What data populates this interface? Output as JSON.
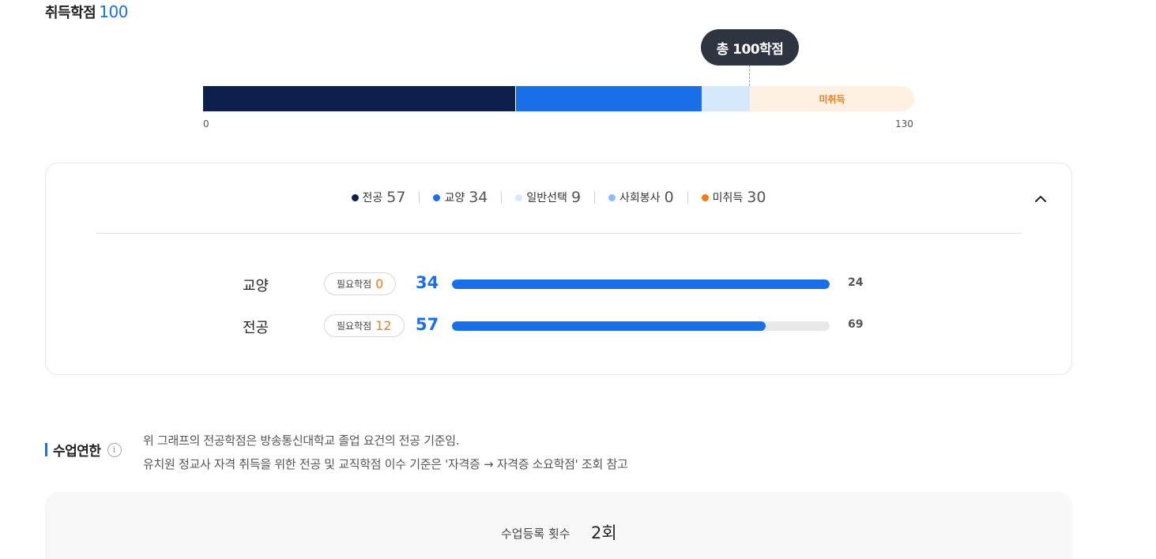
{
  "earned": {
    "label": "취득학점",
    "value": "100"
  },
  "tooltip": "총 100학점",
  "credit_bar": {
    "segments": [
      {
        "key": "major",
        "value": 57,
        "color": "#0d1f4c",
        "label": ""
      },
      {
        "key": "general",
        "value": 34,
        "color": "#1a6fe8",
        "label": ""
      },
      {
        "key": "elective",
        "value": 9,
        "color": "#d6e8fb",
        "label": ""
      },
      {
        "key": "unearned",
        "value": 30,
        "color": "#fff0e4",
        "label": "미취득"
      }
    ],
    "min_label": "0",
    "max_label": "130"
  },
  "legend": [
    {
      "label": "전공",
      "value": "57",
      "color": "#0d1f4c"
    },
    {
      "label": "교양",
      "value": "34",
      "color": "#1a6fe8"
    },
    {
      "label": "일반선택",
      "value": "9",
      "color": "#d6e8fb"
    },
    {
      "label": "사회봉사",
      "value": "0",
      "color": "#8cbef0"
    },
    {
      "label": "미취득",
      "value": "30",
      "color": "#f07c12"
    }
  ],
  "collapse_icon": "chevron-up-icon",
  "rows": [
    {
      "name": "교양",
      "req_label": "필요학점",
      "req_value": "0",
      "current": "34",
      "fill_ratio": 1.0,
      "total": "24"
    },
    {
      "name": "전공",
      "req_label": "필요학점",
      "req_value": "12",
      "current": "57",
      "fill_ratio": 0.83,
      "total": "69"
    }
  ],
  "schedule": {
    "title": "수업연한",
    "info_icon": "info-icon",
    "notes": [
      "위 그래프의 전공학점은 방송통신대학교 졸업 요건의 전공 기준임.",
      "유치원 정교사 자격 취득을 위한 전공 및 교직학점 이수 기준은 '자격증 → 자격증 소요학점' 조회 참고"
    ]
  },
  "registration": {
    "label": "수업등록 횟수",
    "value": "2회"
  }
}
